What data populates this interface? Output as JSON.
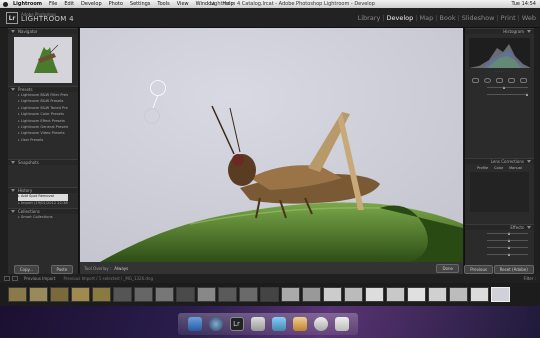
{
  "menubar": {
    "items": [
      "Lightroom",
      "File",
      "Edit",
      "Develop",
      "Photo",
      "Settings",
      "Tools",
      "View",
      "Window",
      "Help"
    ],
    "window_title": "Lightroom 4 Catalog.lrcat - Adobe Photoshop Lightroom - Develop",
    "clock": "Tue 14:54"
  },
  "identity": {
    "logo": "Lr",
    "line1": "Adobe Photoshop",
    "product": "LIGHTROOM 4"
  },
  "modules": {
    "library": "Library",
    "develop": "Develop",
    "map": "Map",
    "book": "Book",
    "slideshow": "Slideshow",
    "print": "Print",
    "web": "Web"
  },
  "left": {
    "navigator": "Navigator",
    "presets": "Presets",
    "preset_items": [
      "Lightroom B&W Filter Presets",
      "Lightroom B&W Presets",
      "Lightroom B&W Toned Presets",
      "Lightroom Color Presets",
      "Lightroom Effect Presets",
      "Lightroom General Presets",
      "Lightroom Video Presets",
      "User Presets"
    ],
    "snapshots": "Snapshots",
    "history": "History",
    "history_items": [
      "Add Spot Removal",
      "Import (19/01/2012 22:36:13)"
    ],
    "collections": "Collections",
    "collection_items": [
      "Smart Collections"
    ],
    "copy": "Copy...",
    "paste": "Paste"
  },
  "toolbar": {
    "overlay_label": "Tool Overlay :",
    "overlay_value": "Always",
    "done": "Done"
  },
  "right": {
    "histogram": "Histogram",
    "lens_corrections": "Lens Corrections",
    "lens_tabs": [
      "Profile",
      "Color",
      "Manual"
    ],
    "effects": "Effects",
    "previous": "Previous",
    "reset": "Reset (Adobe)"
  },
  "filmstrip": {
    "view_label": "Previous Import",
    "path": "Previous Import / 1 selected / _MG_1326.dng",
    "filter_label": "Filter :"
  },
  "colors": {
    "panel": "#2b2b2b",
    "background": "#cfd0d8",
    "leaf": "#5c8a2e",
    "active_module": "#eeeeee"
  }
}
